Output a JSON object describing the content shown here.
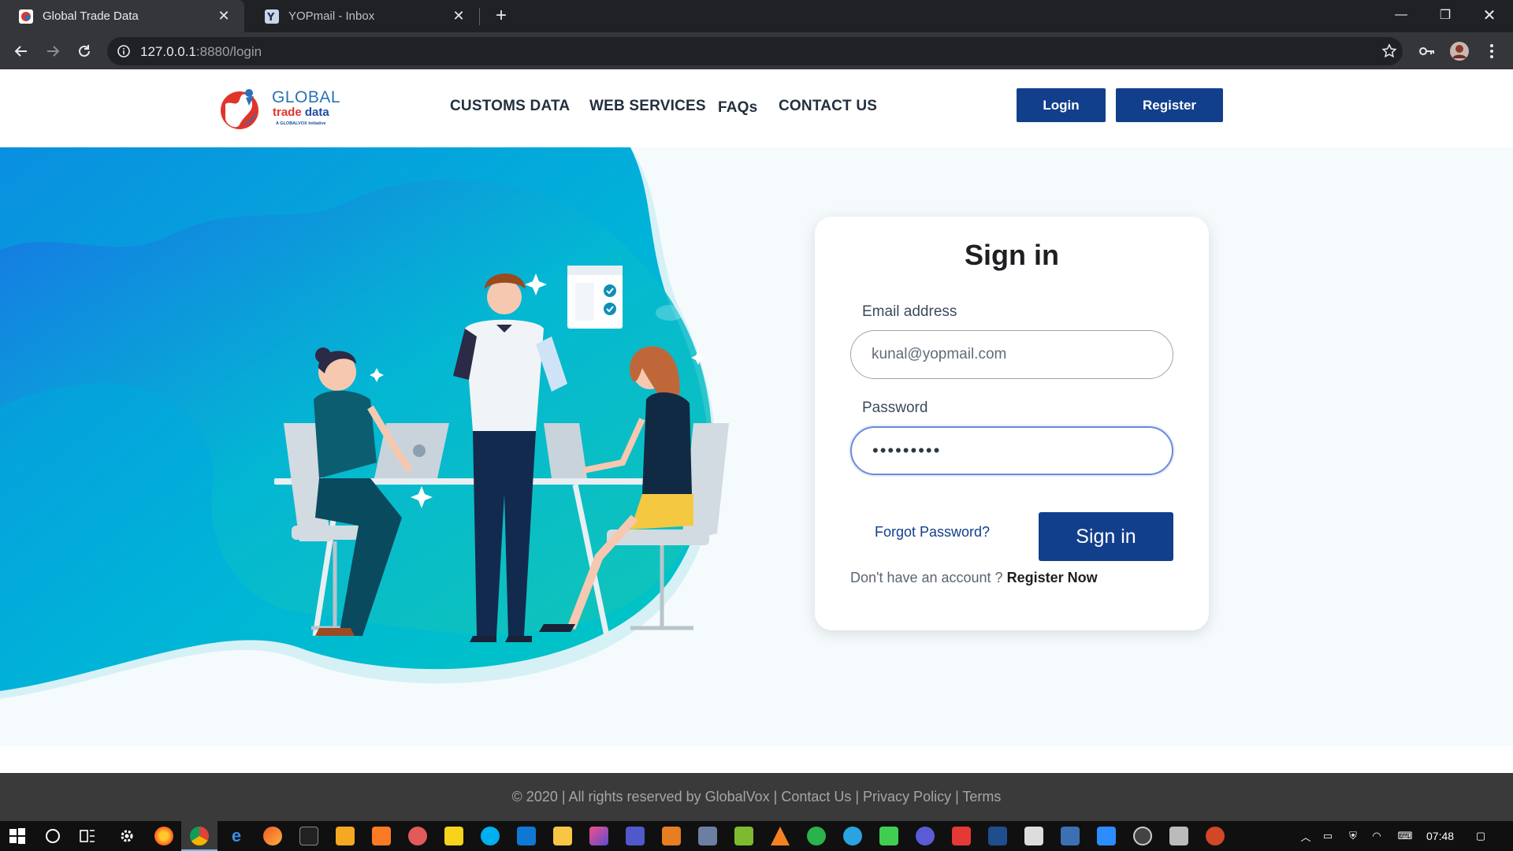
{
  "browser": {
    "tabs": [
      {
        "title": "Global Trade Data",
        "active": true
      },
      {
        "title": "YOPmail - Inbox",
        "active": false
      }
    ],
    "url_host": "127.0.0.1",
    "url_rest": ":8880/login"
  },
  "header": {
    "logo": {
      "line1": "GLOBAL",
      "line2a": "trade ",
      "line2b": "data",
      "tagline": "A GLOBALVOX Initiative"
    },
    "nav": [
      "CUSTOMS DATA",
      "WEB SERVICES",
      "FAQs",
      "CONTACT US"
    ],
    "login_label": "Login",
    "register_label": "Register"
  },
  "signin": {
    "title": "Sign in",
    "email_label": "Email address",
    "email_value": "kunal@yopmail.com",
    "password_label": "Password",
    "password_value": "•••••••••",
    "forgot_label": "Forgot Password?",
    "submit_label": "Sign in",
    "no_account_text": "Don't have an account ?",
    "register_now_label": "Register Now"
  },
  "footer": {
    "text": "© 2020 | All rights reserved by GlobalVox | Contact Us | Privacy Policy | Terms"
  },
  "taskbar": {
    "time": "07:48"
  },
  "colors": {
    "primary": "#123f8c",
    "accent_teal": "#00c2c7",
    "footer_bg": "#3a3a3a"
  }
}
